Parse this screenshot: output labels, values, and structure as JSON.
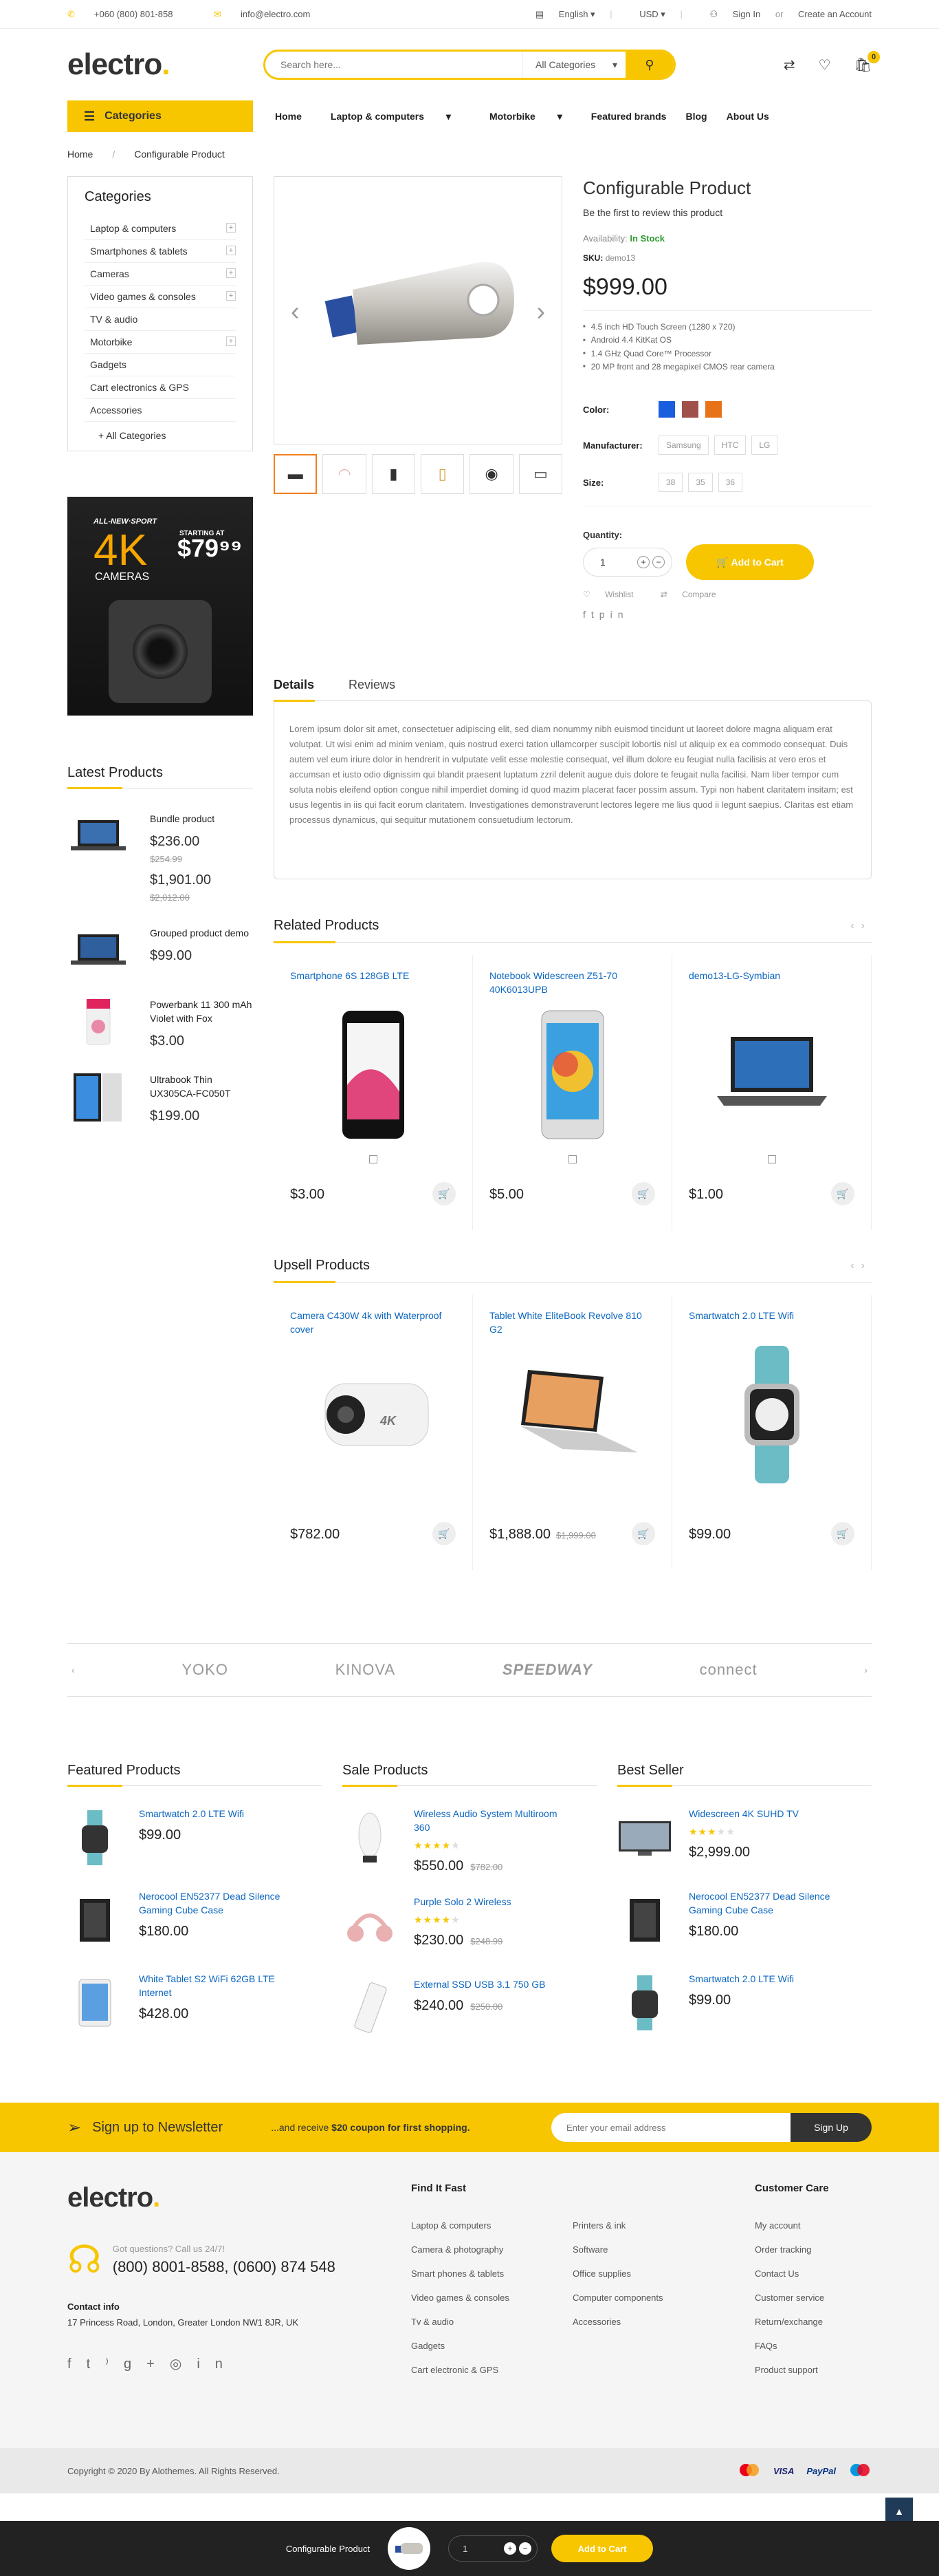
{
  "topbar": {
    "phone": "+060 (800) 801-858",
    "email": "info@electro.com",
    "language": "English",
    "currency": "USD",
    "signin": "Sign In",
    "or": "or",
    "create": "Create an Account"
  },
  "header": {
    "logo": "electro",
    "search_placeholder": "Search here...",
    "search_category": "All Categories",
    "cart_count": "0"
  },
  "nav": {
    "categories_label": "Categories",
    "links": [
      "Home",
      "Laptop & computers",
      "Motorbike",
      "Featured brands",
      "Blog",
      "About Us"
    ]
  },
  "breadcrumb": {
    "home": "Home",
    "current": "Configurable Product"
  },
  "sidebar": {
    "title": "Categories",
    "items": [
      "Laptop & computers",
      "Smartphones & tablets",
      "Cameras",
      "Video games & consoles",
      "TV & audio",
      "Motorbike",
      "Gadgets",
      "Cart electronics & GPS",
      "Accessories"
    ],
    "all": "All Categories",
    "banner": {
      "line1": "ALL-NEW·SPORT",
      "big": "4K",
      "sub": "CAMERAS",
      "starting": "STARTING AT",
      "price": "$79⁹⁹"
    },
    "latest_title": "Latest Products",
    "latest": [
      {
        "name": "Bundle product",
        "price": "$236.00",
        "old": "$254.99",
        "price2": "$1,901.00",
        "old2": "$2,012.00"
      },
      {
        "name": "Grouped product demo",
        "price": "$99.00"
      },
      {
        "name": "Powerbank 11 300 mAh Violet with Fox",
        "price": "$3.00"
      },
      {
        "name": "Ultrabook Thin UX305CA-FC050T",
        "price": "$199.00"
      }
    ]
  },
  "product": {
    "title": "Configurable Product",
    "review": "Be the first to review this product",
    "availability_label": "Availability:",
    "availability": "In Stock",
    "sku_label": "SKU:",
    "sku": "demo13",
    "price": "$999.00",
    "features": [
      "4.5 inch HD Touch Screen (1280 x 720)",
      "Android 4.4 KitKat OS",
      "1.4 GHz Quad Core™ Processor",
      "20 MP front and 28 megapixel CMOS rear camera"
    ],
    "color_label": "Color:",
    "colors": [
      "#1a5ee0",
      "#a0504a",
      "#e87218"
    ],
    "manufacturer_label": "Manufacturer:",
    "manufacturers": [
      "Samsung",
      "HTC",
      "LG"
    ],
    "size_label": "Size:",
    "sizes": [
      "38",
      "35",
      "36"
    ],
    "qty_label": "Quantity:",
    "qty": "1",
    "add_to_cart": "Add to Cart",
    "wishlist": "Wishlist",
    "compare": "Compare"
  },
  "tabs": {
    "details": "Details",
    "reviews": "Reviews",
    "body": "Lorem ipsum dolor sit amet, consectetuer adipiscing elit, sed diam nonummy nibh euismod tincidunt ut laoreet dolore magna aliquam erat volutpat. Ut wisi enim ad minim veniam, quis nostrud exerci tation ullamcorper suscipit lobortis nisl ut aliquip ex ea commodo consequat. Duis autem vel eum iriure dolor in hendrerit in vulputate velit esse molestie consequat, vel illum dolore eu feugiat nulla facilisis at vero eros et accumsan et iusto odio dignissim qui blandit praesent luptatum zzril delenit augue duis dolore te feugait nulla facilisi. Nam liber tempor cum soluta nobis eleifend option congue nihil imperdiet doming id quod mazim placerat facer possim assum. Typi non habent claritatem insitam; est usus legentis in iis qui facit eorum claritatem. Investigationes demonstraverunt lectores legere me lius quod ii legunt saepius. Claritas est etiam processus dynamicus, qui sequitur mutationem consuetudium lectorum."
  },
  "related": {
    "title": "Related Products",
    "items": [
      {
        "name": "Smartphone 6S 128GB LTE",
        "price": "$3.00"
      },
      {
        "name": "Notebook Widescreen Z51-70 40K6013UPB",
        "price": "$5.00"
      },
      {
        "name": "demo13-LG-Symbian",
        "price": "$1.00"
      }
    ]
  },
  "upsell": {
    "title": "Upsell Products",
    "items": [
      {
        "name": "Camera C430W 4k with Waterproof cover",
        "price": "$782.00",
        "old": ""
      },
      {
        "name": "Tablet White EliteBook Revolve 810 G2",
        "price": "$1,888.00",
        "old": "$1,999.00"
      },
      {
        "name": "Smartwatch 2.0 LTE Wifi",
        "price": "$99.00",
        "old": ""
      }
    ]
  },
  "brands": [
    "YOKO",
    "KINOVA",
    "SPEEDWAY",
    "connect"
  ],
  "featured": {
    "title": "Featured Products",
    "items": [
      {
        "name": "Smartwatch 2.0 LTE Wifi",
        "price": "$99.00"
      },
      {
        "name": "Nerocool EN52377 Dead Silence Gaming Cube Case",
        "price": "$180.00"
      },
      {
        "name": "White Tablet S2 WiFi 62GB LTE Internet",
        "price": "$428.00"
      }
    ]
  },
  "sale": {
    "title": "Sale Products",
    "items": [
      {
        "name": "Wireless Audio System Multiroom 360",
        "price": "$550.00",
        "old": "$782.00"
      },
      {
        "name": "Purple Solo 2 Wireless",
        "price": "$230.00",
        "old": "$248.99"
      },
      {
        "name": "External SSD USB 3.1 750 GB",
        "price": "$240.00",
        "old": "$250.00"
      }
    ]
  },
  "best": {
    "title": "Best Seller",
    "items": [
      {
        "name": "Widescreen 4K SUHD TV",
        "price": "$2,999.00"
      },
      {
        "name": "Nerocool EN52377 Dead Silence Gaming Cube Case",
        "price": "$180.00"
      },
      {
        "name": "Smartwatch 2.0 LTE Wifi",
        "price": "$99.00"
      }
    ]
  },
  "newsletter": {
    "title": "Sign up to Newsletter",
    "sub_pre": "...and receive",
    "sub_bold": "$20 coupon for first shopping.",
    "placeholder": "Enter your email address",
    "button": "Sign Up"
  },
  "footer": {
    "logo": "electro",
    "question": "Got questions? Call us 24/7!",
    "phones": "(800) 8001-8588, (0600) 874 548",
    "contact_title": "Contact info",
    "address": "17 Princess Road, London, Greater London NW1 8JR, UK",
    "find_title": "Find It Fast",
    "find_col1": [
      "Laptop & computers",
      "Camera & photography",
      "Smart phones & tablets",
      "Video games & consoles",
      "Tv & audio",
      "Gadgets",
      "Cart electronic & GPS"
    ],
    "find_col2": [
      "Printers & ink",
      "Software",
      "Office supplies",
      "Computer components",
      "Accessories"
    ],
    "care_title": "Customer Care",
    "care": [
      "My account",
      "Order tracking",
      "Contact Us",
      "Customer service",
      "Return/exchange",
      "FAQs",
      "Product support"
    ],
    "copyright": "Copyright © 2020 By Alothemes. All Rights Reserved.",
    "payments": [
      "VISA",
      "PayPal"
    ]
  },
  "sticky": {
    "name": "Configurable Product",
    "qty": "1",
    "button": "Add to Cart"
  }
}
